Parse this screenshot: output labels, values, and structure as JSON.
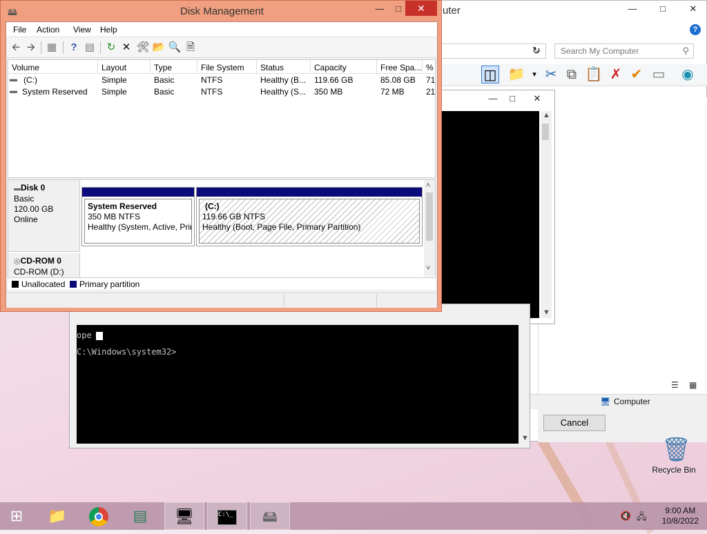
{
  "explorer": {
    "title_partial": "uter",
    "search_placeholder": "Search My Computer",
    "status_computer": "Computer",
    "cancel_label": "Cancel"
  },
  "console": {
    "line_partial": "ope",
    "prompt": "C:\\Windows\\system32>"
  },
  "disk_mgmt": {
    "title": "Disk Management",
    "menu": [
      "File",
      "Action",
      "View",
      "Help"
    ],
    "columns": [
      "Volume",
      "Layout",
      "Type",
      "File System",
      "Status",
      "Capacity",
      "Free Spa...",
      "% F"
    ],
    "volumes": [
      {
        "volume": "(C:)",
        "layout": "Simple",
        "type": "Basic",
        "fs": "NTFS",
        "status": "Healthy (B...",
        "capacity": "119.66 GB",
        "free": "85.08 GB",
        "pct": "71"
      },
      {
        "volume": "System Reserved",
        "layout": "Simple",
        "type": "Basic",
        "fs": "NTFS",
        "status": "Healthy (S...",
        "capacity": "350 MB",
        "free": "72 MB",
        "pct": "21"
      }
    ],
    "disk0": {
      "name": "Disk 0",
      "type": "Basic",
      "size": "120.00 GB",
      "state": "Online",
      "partitions": [
        {
          "name": "System Reserved",
          "size": "350 MB NTFS",
          "status": "Healthy (System, Active, Prir"
        },
        {
          "name": "(C:)",
          "size": "119.66 GB NTFS",
          "status": "Healthy (Boot, Page File, Primary Partition)"
        }
      ]
    },
    "cdrom0": {
      "name": "CD-ROM 0",
      "sub": "CD-ROM (D:)"
    },
    "legend": {
      "unallocated": "Unallocated",
      "primary": "Primary partition",
      "unallocated_color": "#000000",
      "primary_color": "#0a0a7a"
    }
  },
  "desktop": {
    "recycle_bin": "Recycle Bin"
  },
  "taskbar": {
    "time": "9:00 AM",
    "date": "10/8/2022"
  }
}
